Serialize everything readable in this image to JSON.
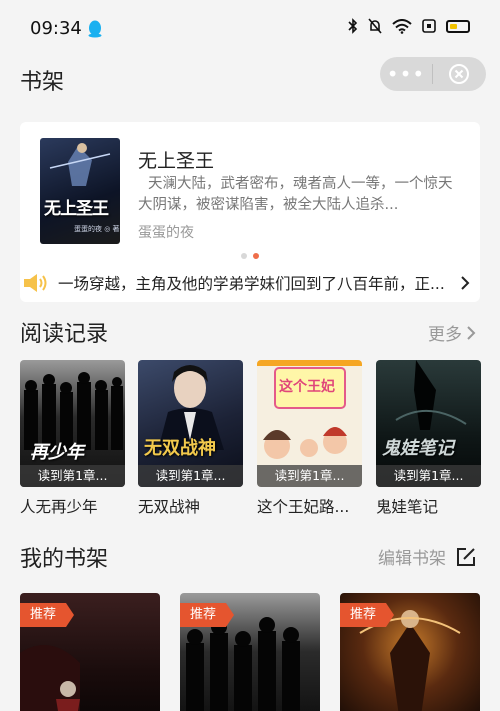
{
  "status_bar": {
    "time": "09:34"
  },
  "nav": {
    "title": "书架",
    "more_label": "•••"
  },
  "featured": {
    "cover_text": "无上圣王",
    "cover_sub": "蛋蛋的夜 ◎ 著",
    "title": "无上圣王",
    "description": "天澜大陆，武者密布，魂者高人一等，一个惊天大阴谋，被密谋陷害，被全大陆人追杀...",
    "author": "蛋蛋的夜",
    "carousel_total": 2,
    "carousel_active": 2
  },
  "notice": {
    "text": "一场穿越，主角及他的学弟学妹们回到了八百年前，正..."
  },
  "history": {
    "title": "阅读记录",
    "more_label": "更多",
    "items": [
      {
        "name": "人无再少年",
        "progress": "读到第1章...",
        "art": "再少年"
      },
      {
        "name": "无双战神",
        "progress": "读到第1章...",
        "art": "无双战神"
      },
      {
        "name": "这个王妃路...",
        "progress": "读到第1章...",
        "art": "这个王妃"
      },
      {
        "name": "鬼娃笔记",
        "progress": "读到第1章...",
        "art": "鬼娃笔记"
      }
    ]
  },
  "shelf": {
    "title": "我的书架",
    "edit_label": "编辑书架",
    "items": [
      {
        "tag": "推荐"
      },
      {
        "tag": "推荐"
      },
      {
        "tag": "推荐"
      }
    ]
  },
  "colors": {
    "accent": "#e5552f",
    "background": "#f4f4f4"
  }
}
